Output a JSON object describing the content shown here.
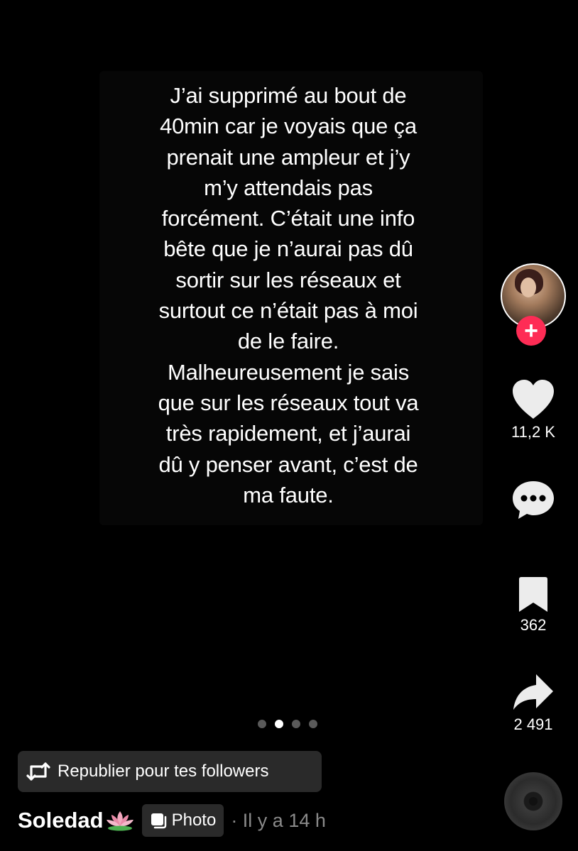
{
  "post": {
    "text": "J’ai supprimé au bout de\n40min car je voyais que ça\nprenait une ampleur et j’y\nm’y attendais pas\nforcément. C’était une info\nbête que je n’aurai pas dû\nsortir sur les réseaux et\nsurtout ce n’était pas à moi\nde le faire.\nMalheureusement je sais\nque sur les réseaux tout va\ntrès rapidement, et j’aurai\ndû y penser avant, c’est de\nma faute."
  },
  "sidebar": {
    "follow_label": "+",
    "likes": "11,2 K",
    "bookmarks": "362",
    "shares": "2 491"
  },
  "carousel": {
    "total": 4,
    "active_index": 1
  },
  "repost": {
    "label": "Republier pour tes followers"
  },
  "author": {
    "username": "Soledad",
    "badge_label": "Photo",
    "time": "· Il y a 14 h"
  },
  "colors": {
    "accent": "#fe2c55",
    "background": "#000000",
    "chip": "#2a2a2a",
    "muted_text": "#8a8a8a"
  },
  "icons": [
    "heart-icon",
    "comment-icon",
    "bookmark-icon",
    "share-icon",
    "repost-icon",
    "photo-icon",
    "lotus-icon",
    "music-disc-icon"
  ]
}
